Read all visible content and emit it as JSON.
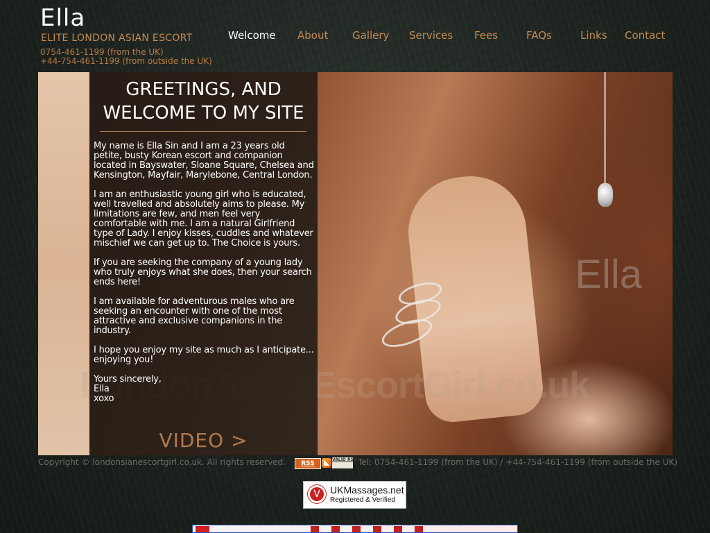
{
  "header": {
    "title": "Ella",
    "tagline": "ELITE LONDON ASIAN ESCORT",
    "phone_uk": "0754-461-1199 (from the UK)",
    "phone_intl": "+44-754-461-1199 (from outside the UK)"
  },
  "nav": {
    "items": [
      {
        "label": "Welcome",
        "active": true
      },
      {
        "label": "About"
      },
      {
        "label": "Gallery"
      },
      {
        "label": "Services"
      },
      {
        "label": "Fees"
      },
      {
        "label": "FAQs"
      },
      {
        "label": "Links"
      },
      {
        "label": "Contact"
      }
    ]
  },
  "welcome": {
    "heading_line1": "GREETINGS, AND",
    "heading_line2": "WELCOME TO MY SITE",
    "paragraphs": [
      "My name is Ella Sin and I am a 23 years old petite, busty Korean escort and companion located in Bayswater, Sloane Square, Chelsea and Kensington, Mayfair, Marylebone, Central London.",
      "I am an enthusiastic young girl who is educated, well travelled and absolutely aims to please. My limitations are few, and men feel very comfortable with me. I am a natural Girlfriend type of Lady. I enjoy kisses, cuddles and whatever mischief we can get up to. The Choice is yours.",
      "If you are seeking the company of a young lady who truly enjoys what she does, then your search ends here!",
      "I am available for adventurous males who are seeking an encounter with one of the most attractive and exclusive companions in the industry.",
      "I hope you enjoy my site as much as I anticipate... enjoying you!"
    ],
    "sign_line1": "Yours sincerely,",
    "sign_line2": "Ella",
    "sign_line3": "xoxo",
    "video_label": "VIDEO  >"
  },
  "photo": {
    "watermark_name": "Ella",
    "watermark_site": "LondonAsianEscortGirl.co.uk"
  },
  "footer": {
    "copyright": "Copyright © londonsianescortgirl.co.uk. All rights reserved.",
    "rss_label": "RSS",
    "valid_rss_label": "VALID RSS",
    "tel": "Tel: 0754-461-1199 (from the UK) / +44-754-461-1199 (from outside the UK)"
  },
  "badge": {
    "name": "UKMassages.net",
    "sub": "Registered & Verified",
    "logo_letter": "V"
  },
  "colors": {
    "accent": "#c48a55",
    "panel_bg": "#1c1814",
    "text": "#ffffff"
  }
}
